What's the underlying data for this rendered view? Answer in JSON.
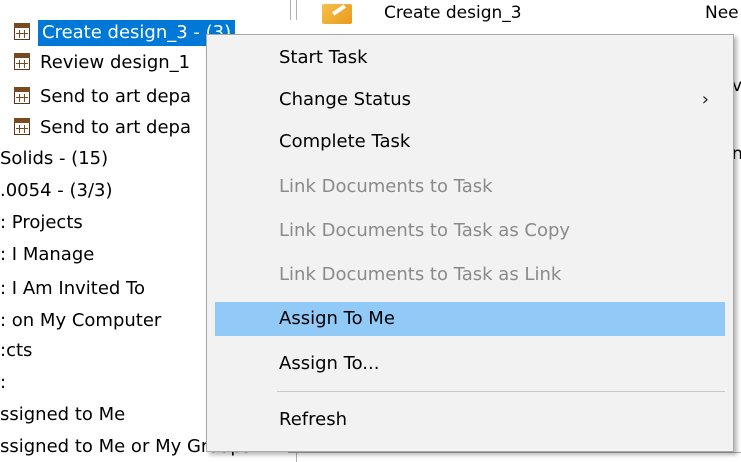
{
  "tree": {
    "partial_top": "…",
    "tasks": [
      {
        "label": "Create design_3 - (3)",
        "selected": true
      },
      {
        "label": "Review design_1",
        "selected": false
      },
      {
        "label": "Send to art depa",
        "selected": false
      },
      {
        "label": "Send to art depa",
        "selected": false
      }
    ],
    "rows": [
      "Solids - (15)",
      ".0054 - (3/3)",
      ": Projects",
      ": I Manage",
      ": I Am Invited To",
      ": on My Computer",
      ":cts",
      ":",
      "ssigned to Me",
      "ssigned to Me or My Groups"
    ]
  },
  "list": {
    "task_name": "Create design_3",
    "status_partial": "Nee",
    "edge_chars": [
      "v",
      "n"
    ]
  },
  "context_menu": {
    "items": [
      {
        "label": "Start Task",
        "enabled": true
      },
      {
        "label": "Change Status",
        "enabled": true,
        "submenu": true
      },
      {
        "label": "Complete Task",
        "enabled": true
      },
      {
        "label": "Link Documents to Task",
        "enabled": false
      },
      {
        "label": "Link Documents to Task as Copy",
        "enabled": false
      },
      {
        "label": "Link Documents to Task as Link",
        "enabled": false
      },
      {
        "label": "Assign To Me",
        "enabled": true,
        "highlighted": true
      },
      {
        "label": "Assign To...",
        "enabled": true
      },
      {
        "label": "Refresh",
        "enabled": true
      }
    ],
    "submenu_arrow": "›"
  },
  "colors": {
    "selection": "#0078d7",
    "menu_bg": "#f2f2f2",
    "menu_hover": "#91c9f7",
    "disabled_text": "#8a8a8a"
  }
}
